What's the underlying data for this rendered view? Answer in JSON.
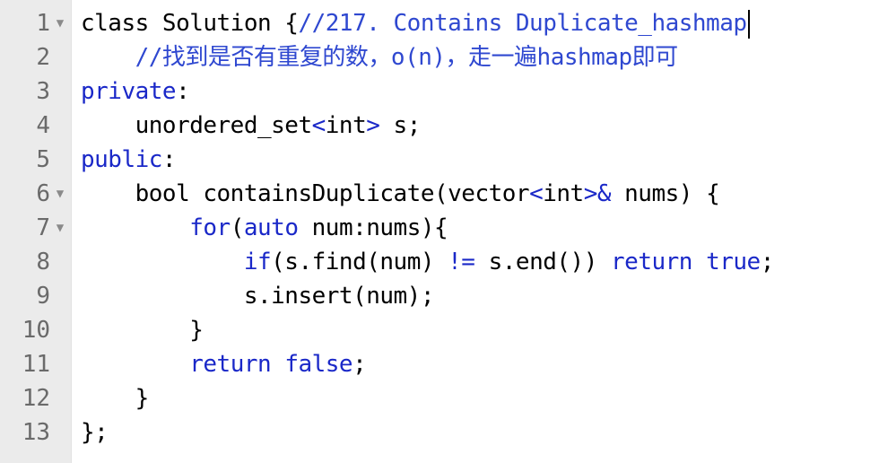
{
  "editor": {
    "lines": [
      {
        "number": "1",
        "has_fold": true,
        "fold_icon": "▼",
        "tokens": [
          {
            "text": "class Solution {",
            "type": "plain"
          },
          {
            "text": "//217. Contains Duplicate_hashmap",
            "type": "comment"
          }
        ]
      },
      {
        "number": "2",
        "has_fold": false,
        "tokens": [
          {
            "text": "    ",
            "type": "plain"
          },
          {
            "text": "//找到是否有重复的数，o(n)，走一遍hashmap即可",
            "type": "comment"
          }
        ]
      },
      {
        "number": "3",
        "has_fold": false,
        "tokens": [
          {
            "text": "private",
            "type": "keyword"
          },
          {
            "text": ":",
            "type": "plain"
          }
        ]
      },
      {
        "number": "4",
        "has_fold": false,
        "tokens": [
          {
            "text": "    unordered_set",
            "type": "plain"
          },
          {
            "text": "<",
            "type": "operator"
          },
          {
            "text": "int",
            "type": "plain"
          },
          {
            "text": ">",
            "type": "operator"
          },
          {
            "text": " s;",
            "type": "plain"
          }
        ]
      },
      {
        "number": "5",
        "has_fold": false,
        "tokens": [
          {
            "text": "public",
            "type": "keyword"
          },
          {
            "text": ":",
            "type": "plain"
          }
        ]
      },
      {
        "number": "6",
        "has_fold": true,
        "fold_icon": "▼",
        "tokens": [
          {
            "text": "    bool containsDuplicate(vector",
            "type": "plain"
          },
          {
            "text": "<",
            "type": "operator"
          },
          {
            "text": "int",
            "type": "plain"
          },
          {
            "text": ">&",
            "type": "operator"
          },
          {
            "text": " nums) {",
            "type": "plain"
          }
        ]
      },
      {
        "number": "7",
        "has_fold": true,
        "fold_icon": "▼",
        "tokens": [
          {
            "text": "        ",
            "type": "plain"
          },
          {
            "text": "for",
            "type": "keyword"
          },
          {
            "text": "(",
            "type": "plain"
          },
          {
            "text": "auto",
            "type": "keyword"
          },
          {
            "text": " num:nums){",
            "type": "plain"
          }
        ]
      },
      {
        "number": "8",
        "has_fold": false,
        "tokens": [
          {
            "text": "            ",
            "type": "plain"
          },
          {
            "text": "if",
            "type": "keyword"
          },
          {
            "text": "(s.find(num) ",
            "type": "plain"
          },
          {
            "text": "!=",
            "type": "operator"
          },
          {
            "text": " s.end()) ",
            "type": "plain"
          },
          {
            "text": "return",
            "type": "keyword"
          },
          {
            "text": " ",
            "type": "plain"
          },
          {
            "text": "true",
            "type": "keyword"
          },
          {
            "text": ";",
            "type": "plain"
          }
        ]
      },
      {
        "number": "9",
        "has_fold": false,
        "tokens": [
          {
            "text": "            s.insert(num);",
            "type": "plain"
          }
        ]
      },
      {
        "number": "10",
        "has_fold": false,
        "tokens": [
          {
            "text": "        }",
            "type": "plain"
          }
        ]
      },
      {
        "number": "11",
        "has_fold": false,
        "tokens": [
          {
            "text": "        ",
            "type": "plain"
          },
          {
            "text": "return",
            "type": "keyword"
          },
          {
            "text": " ",
            "type": "plain"
          },
          {
            "text": "false",
            "type": "keyword"
          },
          {
            "text": ";",
            "type": "plain"
          }
        ]
      },
      {
        "number": "12",
        "has_fold": false,
        "tokens": [
          {
            "text": "    }",
            "type": "plain"
          }
        ]
      },
      {
        "number": "13",
        "has_fold": false,
        "tokens": [
          {
            "text": "};",
            "type": "plain"
          }
        ]
      }
    ]
  }
}
